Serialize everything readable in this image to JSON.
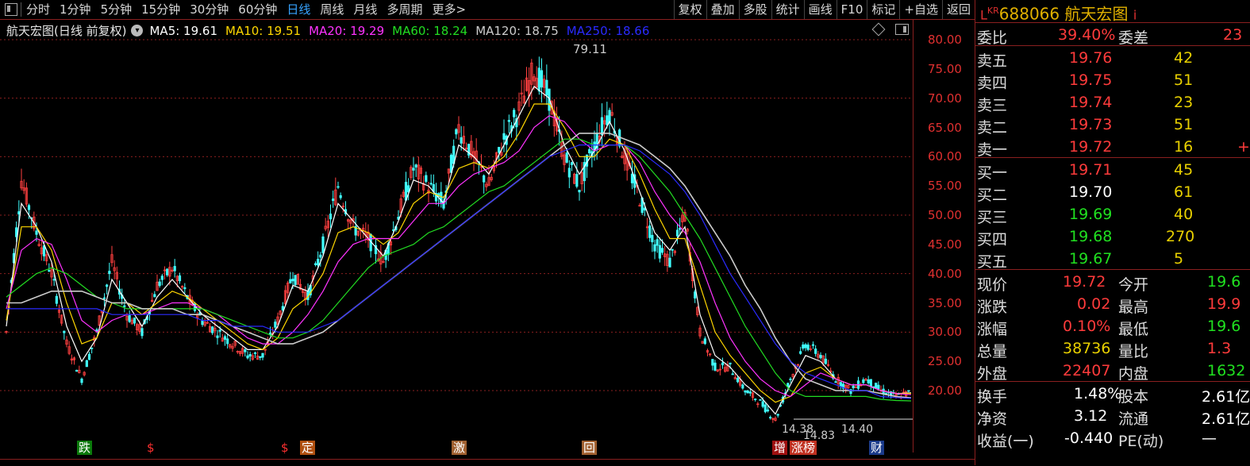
{
  "toolbar": {
    "periods": [
      "分时",
      "1分钟",
      "5分钟",
      "15分钟",
      "30分钟",
      "60分钟",
      "日线",
      "周线",
      "月线",
      "多周期",
      "更多>"
    ],
    "active": "日线",
    "right_buttons": [
      "复权",
      "叠加",
      "多股",
      "统计",
      "画线",
      "F10",
      "标记",
      "+自选",
      "返回"
    ]
  },
  "chart": {
    "title": "航天宏图(日线 前复权)",
    "ma": [
      {
        "label": "MA5: 19.61",
        "color": "#ffffff"
      },
      {
        "label": "MA10: 19.51",
        "color": "#ffd700"
      },
      {
        "label": "MA20: 19.29",
        "color": "#ff33ff"
      },
      {
        "label": "MA60: 18.24",
        "color": "#22dd22"
      },
      {
        "label": "MA120: 18.75",
        "color": "#cccccc"
      },
      {
        "label": "MA250: 18.66",
        "color": "#2a2aff"
      }
    ],
    "y_ticks": [
      "80.00",
      "75.00",
      "70.00",
      "65.00",
      "60.00",
      "55.00",
      "50.00",
      "45.00",
      "40.00",
      "35.00",
      "30.00",
      "25.00",
      "20.00"
    ],
    "peak_label": "79.11",
    "low_labels": [
      "14.38",
      "14.83",
      "14.40"
    ],
    "markers": [
      {
        "text": "跌",
        "bg": "#0a7a0a",
        "color": "#fff"
      },
      {
        "text": "$",
        "bg": "transparent",
        "color": "#ff3030"
      },
      {
        "text": "$",
        "bg": "transparent",
        "color": "#ff3030"
      },
      {
        "text": "定",
        "bg": "#b05010",
        "color": "#fff"
      },
      {
        "text": "激",
        "bg": "#a06030",
        "color": "#fff"
      },
      {
        "text": "回",
        "bg": "#a06030",
        "color": "#fff"
      },
      {
        "text": "增",
        "bg": "#a01010",
        "color": "#fff"
      },
      {
        "text": "涨榜",
        "bg": "#c03020",
        "color": "#fff"
      },
      {
        "text": "财",
        "bg": "#1a3a8a",
        "color": "#fff"
      }
    ],
    "colors": {
      "up": "#ff4040",
      "down": "#40ffff",
      "grid": "#8a1f1f",
      "ma250": "#2a2aff"
    }
  },
  "chart_data": {
    "type": "line",
    "title": "航天宏图(日线 前复权)",
    "ylim": [
      18,
      82
    ],
    "series": [
      {
        "name": "close",
        "values": [
          30,
          56,
          47,
          40,
          28,
          22,
          30,
          42,
          33,
          30,
          38,
          41,
          36,
          32,
          30,
          28,
          26,
          26,
          32,
          40,
          36,
          45,
          55,
          48,
          46,
          42,
          50,
          58,
          55,
          52,
          65,
          60,
          55,
          63,
          68,
          75,
          70,
          60,
          55,
          62,
          68,
          60,
          53,
          45,
          42,
          50,
          30,
          24,
          24,
          20,
          18,
          15,
          22,
          28,
          26,
          22,
          20,
          22,
          20,
          19,
          19.72
        ]
      },
      {
        "name": "MA5: 19.61",
        "values": [
          31,
          52,
          48,
          42,
          31,
          25,
          29,
          39,
          35,
          31,
          36,
          39,
          36,
          33,
          31,
          29,
          27,
          27,
          31,
          38,
          37,
          43,
          52,
          49,
          46,
          43,
          49,
          56,
          55,
          52,
          62,
          60,
          57,
          62,
          67,
          72,
          70,
          62,
          57,
          61,
          66,
          61,
          54,
          47,
          44,
          48,
          33,
          26,
          24,
          21,
          19,
          16,
          21,
          26,
          25,
          22,
          21,
          21,
          20,
          19.5,
          19.61
        ]
      },
      {
        "name": "MA10: 19.51",
        "values": [
          32,
          48,
          48,
          44,
          35,
          28,
          29,
          35,
          35,
          33,
          35,
          37,
          36,
          34,
          32,
          30,
          28,
          27,
          29,
          34,
          36,
          40,
          47,
          48,
          47,
          45,
          47,
          52,
          54,
          53,
          58,
          59,
          58,
          60,
          64,
          69,
          69,
          65,
          60,
          60,
          63,
          62,
          57,
          51,
          46,
          46,
          38,
          30,
          26,
          23,
          20,
          18,
          19,
          23,
          24,
          22,
          21,
          21,
          20,
          19.5,
          19.51
        ]
      },
      {
        "name": "MA20: 19.29",
        "values": [
          34,
          44,
          46,
          45,
          39,
          32,
          30,
          32,
          33,
          33,
          34,
          35,
          35,
          34,
          33,
          31,
          29,
          28,
          28,
          30,
          33,
          37,
          42,
          45,
          46,
          46,
          46,
          49,
          52,
          52,
          55,
          57,
          58,
          59,
          61,
          65,
          67,
          66,
          63,
          61,
          62,
          62,
          59,
          54,
          50,
          47,
          42,
          35,
          29,
          25,
          22,
          20,
          19,
          21,
          23,
          22,
          21,
          21,
          20,
          19.5,
          19.29
        ]
      },
      {
        "name": "MA60: 18.24",
        "values": [
          36,
          38,
          40,
          41,
          40,
          38,
          36,
          35,
          34,
          34,
          34,
          34,
          34,
          34,
          33,
          32,
          31,
          30,
          29,
          29,
          30,
          32,
          35,
          38,
          41,
          43,
          44,
          45,
          47,
          48,
          50,
          52,
          54,
          55,
          57,
          59,
          61,
          63,
          63,
          62,
          62,
          62,
          60,
          57,
          54,
          50,
          46,
          41,
          36,
          31,
          27,
          23,
          20,
          19,
          19,
          19,
          19,
          19,
          18.5,
          18.3,
          18.24
        ]
      },
      {
        "name": "MA120: 18.75",
        "values": [
          35,
          35,
          36,
          37,
          37,
          37,
          36,
          35,
          35,
          34,
          34,
          34,
          33,
          33,
          32,
          31,
          30,
          29,
          28,
          28,
          29,
          30,
          32,
          34,
          36,
          38,
          40,
          42,
          44,
          46,
          48,
          50,
          52,
          54,
          56,
          58,
          60,
          62,
          64,
          64,
          64,
          63,
          62,
          60,
          58,
          55,
          51,
          47,
          43,
          38,
          34,
          29,
          25,
          22,
          21,
          20,
          20,
          20,
          19.5,
          19,
          18.75
        ]
      },
      {
        "name": "MA250: 18.66",
        "values": [
          34,
          34,
          34,
          34,
          34,
          34,
          34,
          33,
          33,
          33,
          33,
          33,
          33,
          32,
          32,
          31,
          31,
          31,
          30,
          30,
          30,
          31,
          32,
          34,
          36,
          38,
          40,
          42,
          44,
          46,
          48,
          50,
          52,
          54,
          56,
          58,
          60,
          61,
          62,
          62,
          62,
          62,
          61,
          59,
          57,
          54,
          50,
          45,
          40,
          36,
          32,
          28,
          25,
          23,
          22,
          21,
          20,
          20,
          19,
          18.8,
          18.66
        ]
      }
    ]
  },
  "panel": {
    "code": "688066",
    "name": "航天宏图",
    "prefix": "L",
    "prefix_sup": "KR",
    "info_icon": "i",
    "weibi": {
      "label": "委比",
      "value": "39.40%",
      "label2": "委差",
      "value2": "23"
    },
    "sell": [
      {
        "label": "卖五",
        "price": "19.76",
        "vol": "42",
        "ex": ""
      },
      {
        "label": "卖四",
        "price": "19.75",
        "vol": "51",
        "ex": ""
      },
      {
        "label": "卖三",
        "price": "19.74",
        "vol": "23",
        "ex": ""
      },
      {
        "label": "卖二",
        "price": "19.73",
        "vol": "51",
        "ex": ""
      },
      {
        "label": "卖一",
        "price": "19.72",
        "vol": "16",
        "ex": "+"
      }
    ],
    "buy": [
      {
        "label": "买一",
        "price": "19.71",
        "vol": "45",
        "pc": "red"
      },
      {
        "label": "买二",
        "price": "19.70",
        "vol": "61",
        "pc": "white"
      },
      {
        "label": "买三",
        "price": "19.69",
        "vol": "40",
        "pc": "green"
      },
      {
        "label": "买四",
        "price": "19.68",
        "vol": "270",
        "pc": "green"
      },
      {
        "label": "买五",
        "price": "19.67",
        "vol": "5",
        "pc": "green"
      }
    ],
    "quote": [
      {
        "l1": "现价",
        "v1": "19.72",
        "c1": "red",
        "l2": "今开",
        "v2": "19.6",
        "c2": "green"
      },
      {
        "l1": "涨跌",
        "v1": "0.02",
        "c1": "red",
        "l2": "最高",
        "v2": "19.9",
        "c2": "red"
      },
      {
        "l1": "涨幅",
        "v1": "0.10%",
        "c1": "red",
        "l2": "最低",
        "v2": "19.6",
        "c2": "green"
      },
      {
        "l1": "总量",
        "v1": "38736",
        "c1": "yellow",
        "l2": "量比",
        "v2": "1.3",
        "c2": "red"
      },
      {
        "l1": "外盘",
        "v1": "22407",
        "c1": "red",
        "l2": "内盘",
        "v2": "1632",
        "c2": "green"
      }
    ],
    "fund": [
      {
        "l1": "换手",
        "v1": "1.48%",
        "l2": "股本",
        "v2": "2.61亿"
      },
      {
        "l1": "净资",
        "v1": "3.12",
        "l2": "流通",
        "v2": "2.61亿"
      },
      {
        "l1": "收益(一)",
        "v1": "-0.440",
        "l2": "PE(动)",
        "v2": "—"
      }
    ]
  }
}
